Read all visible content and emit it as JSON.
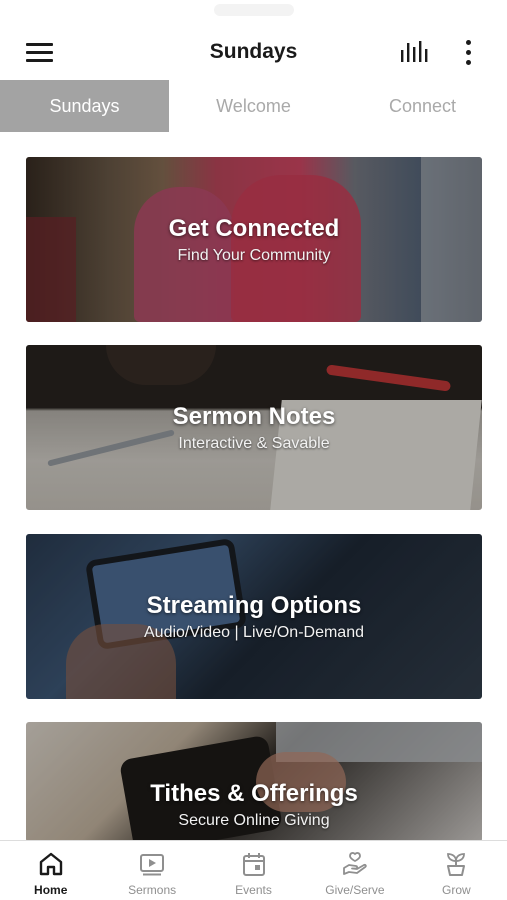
{
  "header": {
    "title": "Sundays",
    "menu_icon": "hamburger-menu-icon",
    "audio_icon": "audio-bars-icon",
    "more_icon": "more-vertical-icon"
  },
  "tabs": [
    {
      "label": "Sundays",
      "active": true
    },
    {
      "label": "Welcome",
      "active": false
    },
    {
      "label": "Connect",
      "active": false
    }
  ],
  "cards": [
    {
      "title": "Get Connected",
      "subtitle": "Find Your Community"
    },
    {
      "title": "Sermon Notes",
      "subtitle": "Interactive & Savable"
    },
    {
      "title": "Streaming Options",
      "subtitle": "Audio/Video | Live/On-Demand"
    },
    {
      "title": "Tithes & Offerings",
      "subtitle": "Secure Online Giving"
    }
  ],
  "bottom_nav": [
    {
      "label": "Home",
      "icon": "home-icon",
      "active": true
    },
    {
      "label": "Sermons",
      "icon": "video-play-icon",
      "active": false
    },
    {
      "label": "Events",
      "icon": "calendar-icon",
      "active": false
    },
    {
      "label": "Give/Serve",
      "icon": "giving-hand-icon",
      "active": false
    },
    {
      "label": "Grow",
      "icon": "sprout-icon",
      "active": false
    }
  ],
  "colors": {
    "active_tab_bg": "#a3a3a3",
    "inactive_tab_text": "#a9a9a9",
    "text_dark": "#1a1a1a",
    "nav_inactive": "#8f8f8f"
  }
}
